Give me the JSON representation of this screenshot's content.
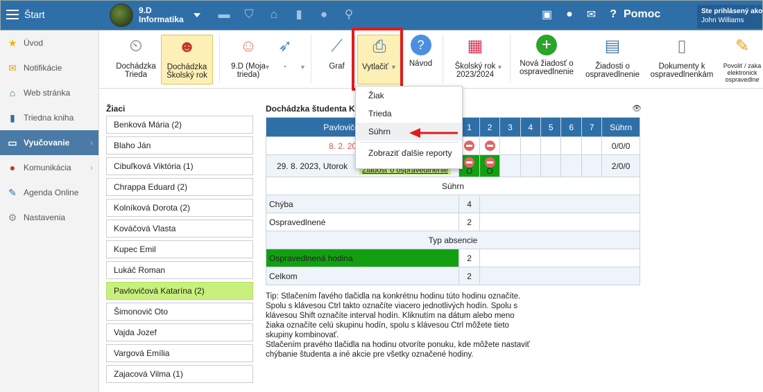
{
  "topbar": {
    "start": "Štart",
    "class_line1": "9.D",
    "class_line2": "Informatika",
    "help": "Pomoc",
    "user_line1": "Ste prihlásený ako",
    "user_line2": "John Williams"
  },
  "sidebar": {
    "items": [
      {
        "label": "Úvod",
        "icon": "star-icon"
      },
      {
        "label": "Notifikácie",
        "icon": "envelope-icon"
      },
      {
        "label": "Web stránka",
        "icon": "home-icon"
      },
      {
        "label": "Triedna kniha",
        "icon": "book-icon"
      },
      {
        "label": "Vyučovanie",
        "icon": "open-book-icon"
      },
      {
        "label": "Komunikácia",
        "icon": "chat-icon"
      },
      {
        "label": "Agenda Online",
        "icon": "pen-icon"
      },
      {
        "label": "Nastavenia",
        "icon": "gear-icon"
      }
    ]
  },
  "ribbon": {
    "b1_l1": "Dochádzka",
    "b1_l2": "Trieda",
    "b2_l1": "Dochádzka",
    "b2_l2": "Školský rok",
    "b3_l1": "9.D (Moja",
    "b3_l2": "trieda)",
    "b4": "-",
    "b5": "Graf",
    "b6": "Vytlačiť",
    "b7": "Návod",
    "b8_l1": "Školský rok",
    "b8_l2": "2023/2024",
    "b9_l1": "Nová žiadosť o",
    "b9_l2": "ospravedlnenie",
    "b10_l1": "Žiadosti o",
    "b10_l2": "ospravedlnenie",
    "b11_l1": "Dokumenty k",
    "b11_l2": "ospravedlnenkám",
    "b12_l1": "Povoliť / zaka",
    "b12_l2": "elektronick",
    "b12_l3": "ospravedlne"
  },
  "students_heading": "Žiaci",
  "students": [
    "Benková Mária (2)",
    "Blaho Ján",
    "Cibuľková Viktória (1)",
    "Chrappa Eduard (2)",
    "Kolníková Dorota (2)",
    "Kováčová Vlasta",
    "Kupec Emil",
    "Lukáč Roman",
    "Pavlovičová Katarína (2)",
    "Šimonovič Oto",
    "Vajda Jozef",
    "Vargová Emília",
    "Zajacová Vilma (1)"
  ],
  "attendance": {
    "heading": "Dochádzka študenta Ka",
    "student_name": "Pavlovičová Katarína",
    "hours": [
      "1",
      "2",
      "3",
      "4",
      "5",
      "6",
      "7"
    ],
    "sum_label": "Súhrn",
    "row1_date": "8. 2. 2024, Štvrtok",
    "row1_sum": "0/0/0",
    "row2_date": "29. 8. 2023, Utorok",
    "row2_request": "Žiadosť o ospravedlnenie",
    "row2_o1": "O",
    "row2_o2": "O",
    "row2_sum": "2/0/0",
    "summary_title": "Súhrn",
    "chyba_label": "Chýba",
    "chyba_value": "4",
    "ospr_label": "Ospravedlnené",
    "ospr_value": "2",
    "type_title": "Typ absencie",
    "ospr_hodina_label": "Ospravedlnená hodina",
    "ospr_hodina_value": "2",
    "celkom_label": "Celkom",
    "celkom_value": "2"
  },
  "dropdown": {
    "items": [
      "Žiak",
      "Trieda",
      "Súhrn"
    ],
    "extra": "Zobraziť ďalšie reporty"
  },
  "tip": {
    "l1": "Tip: Stlačením ľavého tlačidla na konkrétnu hodinu túto hodinu označíte.",
    "l2": "Spolu s klávesou Ctrl takto označíte viacero jednotlivých hodín. Spolu s",
    "l3": "klávesou Shift označíte interval hodín. Kliknutím na dátum alebo meno",
    "l4": "žiaka označíte celú skupinu hodín, spolu s klávesou Ctrl môžete tieto",
    "l5": "skupiny kombinovať.",
    "l6": "Stlačením pravého tlačidla na hodinu otvoríte ponuku, kde môžete nastaviť",
    "l7": "chýbanie študenta a iné akcie pre všetky označené hodiny."
  },
  "colors": {
    "accent": "#2f6fa8",
    "selected_student": "#c8f07c",
    "excused": "#12a012",
    "highlight_box": "#e21b1b"
  }
}
